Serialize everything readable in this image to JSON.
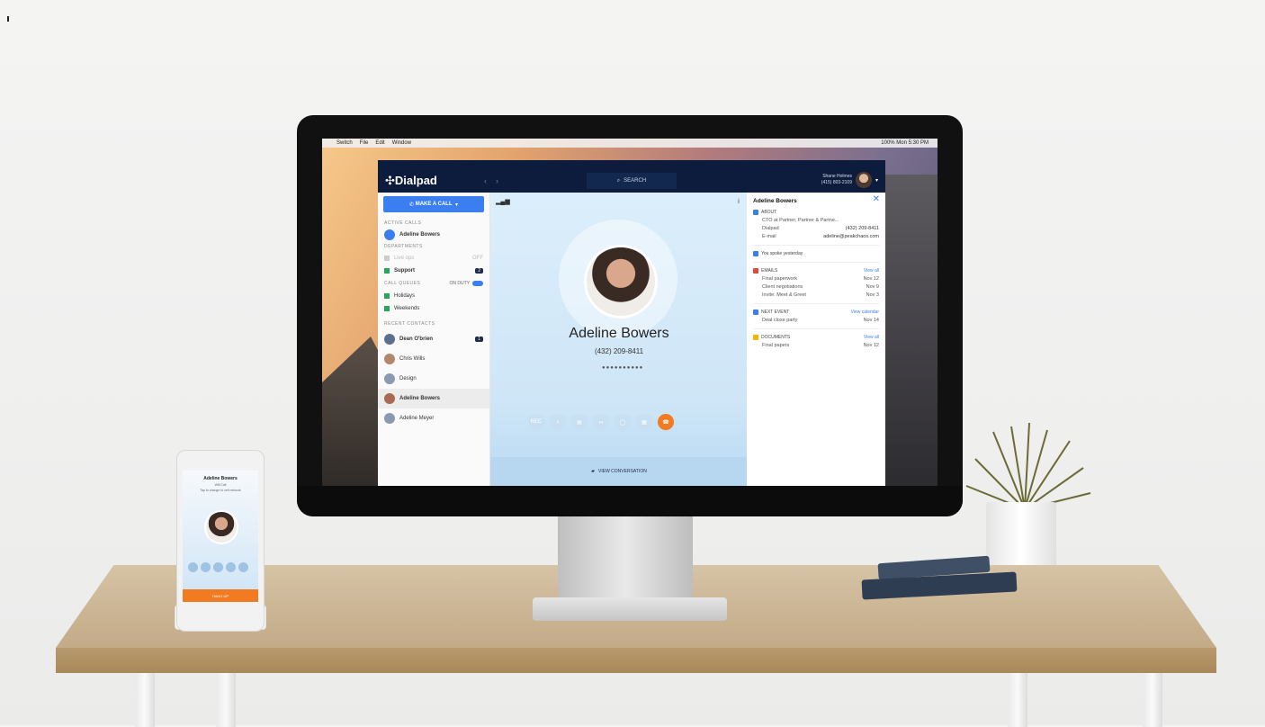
{
  "menubar": {
    "items": [
      "Switch",
      "File",
      "Edit",
      "Window"
    ],
    "right": "100%  Mon 5:30 PM"
  },
  "app": {
    "logo": "Dialpad",
    "search_label": "SEARCH",
    "user_name": "Shane Holmes",
    "user_number": "(415) 803-2109",
    "sidebar": {
      "make_call": "MAKE A CALL",
      "active_calls_label": "ACTIVE CALLS",
      "active_call": "Adeline Bowers",
      "departments_label": "DEPARTMENTS",
      "live_ops": "Live ops",
      "live_ops_status": "OFF",
      "support": "Support",
      "support_badge": "2",
      "call_queues_label": "CALL QUEUES",
      "on_duty": "ON DUTY",
      "queues": [
        "Holidays",
        "Weekends"
      ],
      "recent_contacts_label": "RECENT CONTACTS",
      "contacts": [
        "Dean O'brien",
        "Chris Wills",
        "Design",
        "Adeline Bowers",
        "Adeline Meyer"
      ],
      "dean_badge": "1"
    },
    "call": {
      "name": "Adeline Bowers",
      "number": "(432) 209-8411",
      "controls": [
        "REC",
        "Transfer",
        "Notes",
        "Forward",
        "Add",
        "Keypad",
        "Hang up"
      ],
      "view_conversation": "VIEW CONVERSATION"
    },
    "details": {
      "title": "Adeline Bowers",
      "about_label": "ABOUT",
      "job": "CTO at Partner, Partner & Partne...",
      "dialpad_label": "Dialpad",
      "dialpad_value": "(432) 209-8411",
      "email_label": "E-mail",
      "email_value": "adeline@peakchaos.com",
      "spoke": "You spoke yesterday",
      "emails_label": "EMAILS",
      "view_all": "View all",
      "emails": [
        {
          "subject": "Final paperwork",
          "date": "Nov 12"
        },
        {
          "subject": "Client negotiations",
          "date": "Nov 9"
        },
        {
          "subject": "Invite: Meet & Greet",
          "date": "Nov 3"
        }
      ],
      "next_event_label": "NEXT EVENT",
      "view_calendar": "View calendar",
      "event": "Deal close party",
      "event_date": "Nov 14",
      "documents_label": "DOCUMENTS",
      "doc": "Final papers",
      "doc_date": "Nov 12"
    }
  },
  "phone": {
    "title": "Adeline Bowers",
    "subtitle": "Wifi Call",
    "subtitle2": "Tap to change to cell network",
    "hangup": "HANG UP"
  },
  "colors": {
    "brand_navy": "#0d1c3d",
    "accent_blue": "#3b7ef0",
    "hangup_orange": "#f27a21",
    "status_green": "#26a65b"
  }
}
